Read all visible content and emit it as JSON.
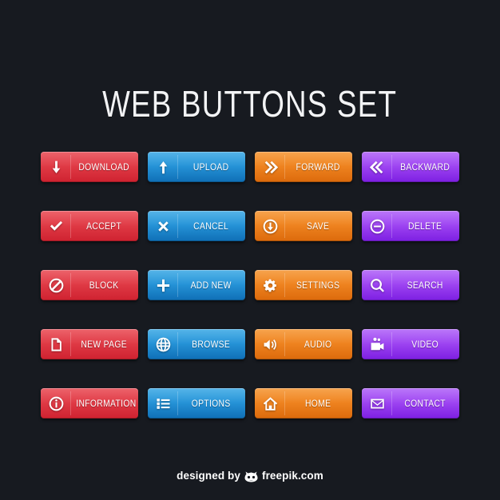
{
  "page": {
    "background_color": "#171a20",
    "title": "WEB BUTTONS SET"
  },
  "palette": {
    "red": "#e03b46",
    "blue": "#2694d8",
    "orange": "#ef8420",
    "purple": "#9f46f2",
    "text": "#ffffff",
    "background": "#171a20"
  },
  "buttons": [
    {
      "label": "DOWNLOAD",
      "icon": "arrow-down-icon",
      "color": "red"
    },
    {
      "label": "UPLOAD",
      "icon": "arrow-up-icon",
      "color": "blue"
    },
    {
      "label": "FORWARD",
      "icon": "double-chevron-right-icon",
      "color": "orange"
    },
    {
      "label": "BACKWARD",
      "icon": "double-chevron-left-icon",
      "color": "purple"
    },
    {
      "label": "ACCEPT",
      "icon": "check-icon",
      "color": "red"
    },
    {
      "label": "CANCEL",
      "icon": "cross-icon",
      "color": "blue"
    },
    {
      "label": "SAVE",
      "icon": "circle-arrow-down-icon",
      "color": "orange"
    },
    {
      "label": "DELETE",
      "icon": "circle-minus-icon",
      "color": "purple"
    },
    {
      "label": "BLOCK",
      "icon": "prohibition-icon",
      "color": "red"
    },
    {
      "label": "ADD NEW",
      "icon": "plus-icon",
      "color": "blue"
    },
    {
      "label": "SETTINGS",
      "icon": "gear-icon",
      "color": "orange"
    },
    {
      "label": "SEARCH",
      "icon": "magnifier-icon",
      "color": "purple"
    },
    {
      "label": "NEW PAGE",
      "icon": "page-icon",
      "color": "red"
    },
    {
      "label": "BROWSE",
      "icon": "globe-icon",
      "color": "blue"
    },
    {
      "label": "AUDIO",
      "icon": "speaker-icon",
      "color": "orange"
    },
    {
      "label": "VIDEO",
      "icon": "video-camera-icon",
      "color": "purple"
    },
    {
      "label": "INFORMATION",
      "icon": "info-circle-icon",
      "color": "red"
    },
    {
      "label": "OPTIONS",
      "icon": "list-icon",
      "color": "blue"
    },
    {
      "label": "HOME",
      "icon": "home-icon",
      "color": "orange"
    },
    {
      "label": "CONTACT",
      "icon": "envelope-icon",
      "color": "purple"
    }
  ],
  "footer": {
    "prefix": "designed by",
    "brand": "freepik.com",
    "logo": "freepik-logo-icon"
  }
}
